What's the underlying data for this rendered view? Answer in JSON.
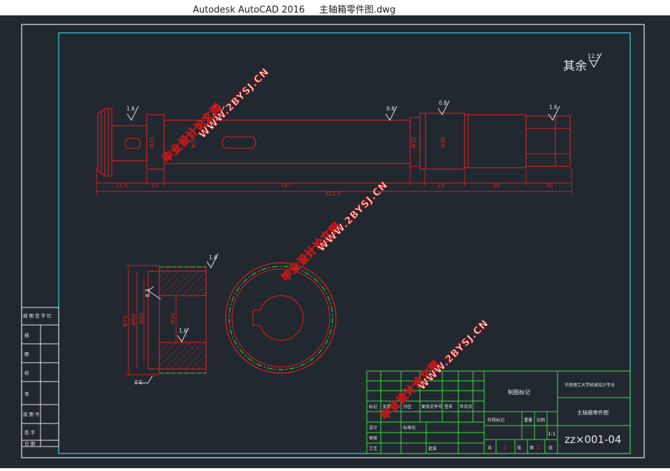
{
  "window": {
    "title": "Autodesk AutoCAD 2016     主轴箱零件图.dwg"
  },
  "drawing": {
    "roughness_note_text": "其余",
    "roughness_note_value": "12.5",
    "roughness": {
      "r1": "1.6",
      "r2": "1.6",
      "r3": "0.8",
      "r4": "0.8",
      "r5": "1.6",
      "r6": "1.6",
      "r7": "6.3",
      "r8": "1.6",
      "r9": "3.2"
    },
    "shaft_dims": {
      "d1": "33.5",
      "d2": "13",
      "d3": "167",
      "d4": "29",
      "d5": "38",
      "d6": "30",
      "total": "323.5",
      "dia1": "Φ35",
      "dia2": "Φ30",
      "dia3": "Φ35",
      "dia4": "Φ38"
    },
    "gear_dims": {
      "od": "Φ74",
      "d2": "Φ69",
      "d3": "Φ60",
      "bore": "Φ38"
    }
  },
  "watermarks": {
    "cn": "毕业设计论文网",
    "url": "WWW.2BYSJ.CN"
  },
  "title_block": {
    "label_left": "制图标记",
    "school": "华南理工大学机械设计专业",
    "part_name": "主轴箱零件图",
    "drawing_no": "zz×001-04",
    "scale": "1:1",
    "qty_a": "1",
    "qty_b": "1",
    "side_labels": [
      "描 图 签 字 栏",
      "描",
      "图",
      "校",
      "审",
      "底 图 号",
      "签 字",
      "日 期"
    ],
    "mini": [
      "标记",
      "处数",
      "分区",
      "更改文件号",
      "签名",
      "年月日",
      "设计",
      "标准化",
      "审核",
      "工艺",
      "批准",
      "阶段标记",
      "重量",
      "比例",
      "共",
      "张",
      "第",
      "张"
    ]
  }
}
